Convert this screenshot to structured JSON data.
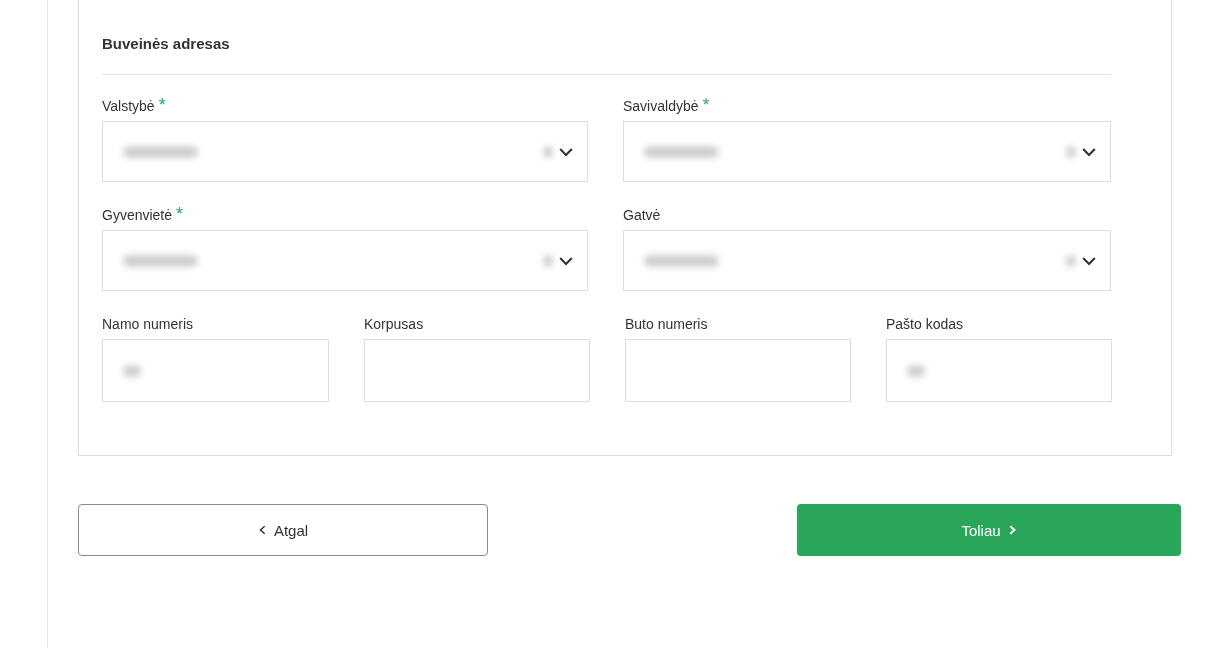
{
  "section": {
    "title": "Buveinės adresas",
    "rows": [
      [
        {
          "label": "Valstybė",
          "required_mark": "*",
          "kind": "select",
          "blurred": true
        },
        {
          "label": "Savivaldybė",
          "required_mark": "*",
          "kind": "select",
          "blurred": true
        }
      ],
      [
        {
          "label": "Gyvenvietė",
          "required_mark": "*",
          "kind": "select",
          "blurred": true
        },
        {
          "label": "Gatvė",
          "kind": "select",
          "blurred": true
        }
      ],
      [
        {
          "label": "Namo numeris",
          "kind": "text",
          "blurred": true
        },
        {
          "label": "Korpusas",
          "kind": "text",
          "blurred": false
        },
        {
          "label": "Buto numeris",
          "kind": "text",
          "blurred": false
        },
        {
          "label": "Pašto kodas",
          "kind": "text",
          "blurred": true
        }
      ]
    ]
  },
  "buttons": [
    {
      "label": "Atgal",
      "kind": "back"
    },
    {
      "label": "Toliau",
      "kind": "next"
    }
  ]
}
